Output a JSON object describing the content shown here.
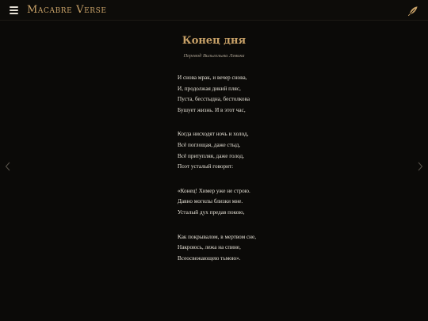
{
  "app": {
    "brand": "Macabre Verse"
  },
  "poem": {
    "title": "Конец дня",
    "translator": "Перевод Вильгельма Левика",
    "stanzas": [
      [
        "И снова мрак, и вечер снова,",
        "И, продолжая дикий пляс,",
        "Пуста, бесстыдна, бестолкова",
        "Бушует жизнь. И в этот час,"
      ],
      [
        "Когда нисходят ночь и холод,",
        "Всё поглощая, даже стыд,",
        "Всё притупляя, даже голод,",
        "Поэт усталый говорит:"
      ],
      [
        "«Конец! Химер уже не строю.",
        "Давно могилы близки мне.",
        "Усталый дух предав покою,"
      ],
      [
        "Как покрывалом, в мертвом сне,",
        "Накроюсь, лежа на спине,",
        "Всеосвежающею тьмою»."
      ]
    ]
  },
  "icons": {
    "menu": "hamburger-icon",
    "quill": "feather-quill-icon",
    "prev": "chevron-left-icon",
    "next": "chevron-right-icon"
  },
  "colors": {
    "background": "#0b0a08",
    "accent": "#c9a268",
    "text": "#e6e1d6",
    "muted": "#a99f8f"
  }
}
